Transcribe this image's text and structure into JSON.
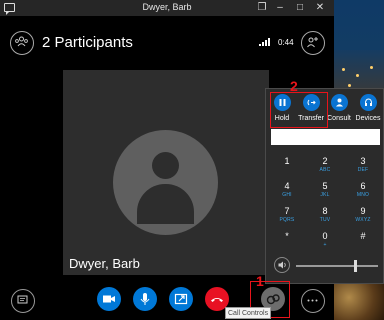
{
  "window": {
    "title": "Dwyer, Barb",
    "buttons": [
      "restore-down",
      "minimize",
      "maximize",
      "close"
    ]
  },
  "header": {
    "participants_label": "2 Participants",
    "call_time": "0:44"
  },
  "video": {
    "participant_name": "Dwyer, Barb"
  },
  "controls": {
    "buttons": [
      {
        "name": "chat",
        "icon": "chat-icon"
      },
      {
        "name": "video",
        "icon": "video-camera-icon"
      },
      {
        "name": "mute",
        "icon": "microphone-icon"
      },
      {
        "name": "present",
        "icon": "share-screen-icon"
      },
      {
        "name": "hang-up",
        "icon": "phone-hangup-icon"
      },
      {
        "name": "call-controls",
        "icon": "call-controls-icon"
      },
      {
        "name": "more-options",
        "icon": "ellipsis-icon"
      }
    ],
    "tooltip": "Call Controls"
  },
  "dialpad": {
    "tabs": [
      {
        "label": "Hold",
        "icon": "pause-icon"
      },
      {
        "label": "Transfer",
        "icon": "transfer-icon"
      },
      {
        "label": "Consult",
        "icon": "person-icon"
      },
      {
        "label": "Devices",
        "icon": "devices-icon"
      }
    ],
    "input_value": "",
    "keys": [
      {
        "digit": "1",
        "letters": ""
      },
      {
        "digit": "2",
        "letters": "ABC"
      },
      {
        "digit": "3",
        "letters": "DEF"
      },
      {
        "digit": "4",
        "letters": "GHI"
      },
      {
        "digit": "5",
        "letters": "JKL"
      },
      {
        "digit": "6",
        "letters": "MNO"
      },
      {
        "digit": "7",
        "letters": "PQRS"
      },
      {
        "digit": "8",
        "letters": "TUV"
      },
      {
        "digit": "9",
        "letters": "WXYZ"
      },
      {
        "digit": "*",
        "letters": ""
      },
      {
        "digit": "0",
        "letters": "+"
      },
      {
        "digit": "#",
        "letters": ""
      }
    ],
    "volume": 0.72
  },
  "annotations": [
    {
      "number": "1",
      "target": "call-controls-button"
    },
    {
      "number": "2",
      "target": "transfer-tab"
    }
  ],
  "colors": {
    "accent": "#0078d7",
    "hangup": "#e81123",
    "annotation": "#e8141b",
    "key_letters": "#3aa3e8"
  }
}
